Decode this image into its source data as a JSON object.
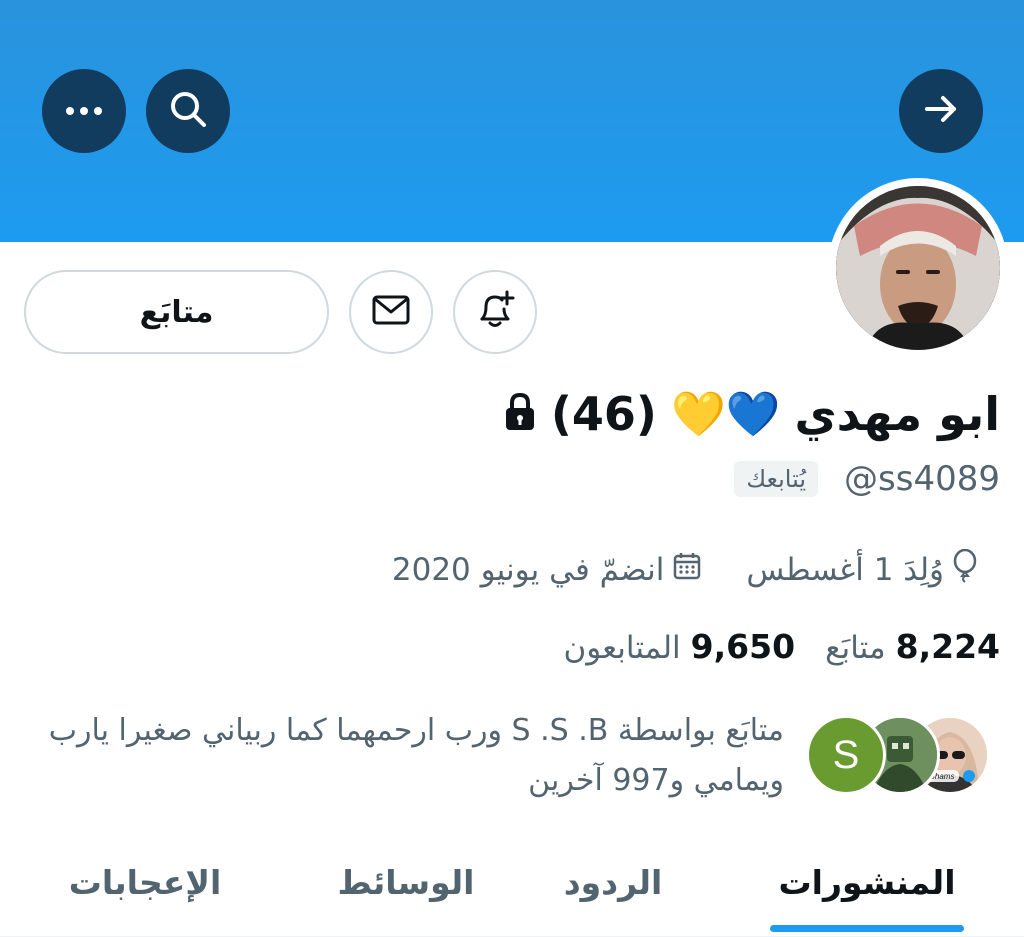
{
  "header": {
    "back_icon": "arrow-right-icon",
    "search_icon": "search-icon",
    "more_icon": "more-horizontal-icon"
  },
  "actions": {
    "follow_label": "متابَع",
    "message_icon": "envelope-icon",
    "notify_icon": "bell-plus-icon"
  },
  "profile": {
    "name": "ابو مهدي",
    "emojis": "💛💙",
    "count": "(46)",
    "lock_icon": "lock-icon",
    "handle": "@ss4089",
    "follows_you": "يُتابعك",
    "birthday": "وُلِدَ 1 أغسطس",
    "joined": "انضمّ في يونيو 2020",
    "following_count": "8,224",
    "following_label": "متابَع",
    "followers_count": "9,650",
    "followers_label": "المتابعون"
  },
  "followed_by": {
    "text": "متابَع بواسطة S .S .B ورب ارحمهما كما ربياني صغيرا يارب ويمامي و997 آخرين",
    "avatar_letter": "S",
    "badge_text": "Shams"
  },
  "tabs": [
    {
      "label": "المنشورات",
      "active": true
    },
    {
      "label": "الردود",
      "active": false
    },
    {
      "label": "الوسائط",
      "active": false
    },
    {
      "label": "الإعجابات",
      "active": false
    }
  ],
  "colors": {
    "accent": "#1d9bf0",
    "banner": "#2a93dd",
    "button_dark": "#123c5e",
    "text": "#0f1419",
    "secondary": "#536471"
  }
}
